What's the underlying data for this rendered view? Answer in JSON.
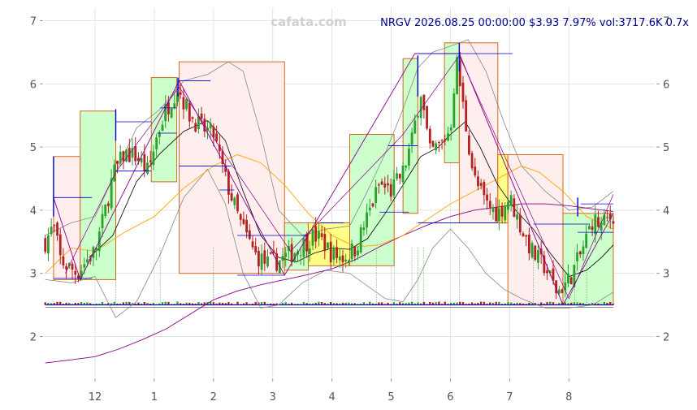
{
  "watermark": "cafata.com",
  "header_text": "NRGV 2026.08.25 00:00:00 $3.93 7.97% vol:3717.6K 0.7x",
  "chart_data": {
    "type": "candlestick",
    "title": "",
    "xlabel": "",
    "ylabel": "",
    "ylim": [
      1.35,
      7.2
    ],
    "x_range_months": [
      10.15,
      20.45
    ],
    "y_ticks": [
      2,
      3,
      4,
      5,
      6,
      7
    ],
    "y_tick_labels": [
      "2",
      "3",
      "4",
      "5",
      "6",
      "7"
    ],
    "x_ticks": [
      {
        "pos": 11,
        "label": "12"
      },
      {
        "pos": 12,
        "label": "1"
      },
      {
        "pos": 13,
        "label": "2"
      },
      {
        "pos": 14,
        "label": "3"
      },
      {
        "pos": 15,
        "label": "4"
      },
      {
        "pos": 16,
        "label": "5"
      },
      {
        "pos": 17,
        "label": "6"
      },
      {
        "pos": 18,
        "label": "7"
      },
      {
        "pos": 19,
        "label": "8"
      }
    ],
    "grid": true,
    "colors": {
      "up": "#2ca02c",
      "down": "#b22222",
      "ma_fast": "#000000",
      "ma_mid": "#ffa500",
      "ma_slow": "#8b008b",
      "bollinger": "#888888",
      "zone_up_fill": "#ccffcc",
      "zone_down_fill": "#ffeeee",
      "zone_neutral_fill": "#ffff88",
      "zone_border": "#d2691e",
      "level_line": "#0000cd",
      "zigzag": "#8b008b"
    },
    "close_series": [
      {
        "x": 10.16,
        "y": 3.5
      },
      {
        "x": 10.3,
        "y": 3.75
      },
      {
        "x": 10.42,
        "y": 3.2
      },
      {
        "x": 10.55,
        "y": 3.1
      },
      {
        "x": 10.7,
        "y": 3.0
      },
      {
        "x": 10.85,
        "y": 3.2
      },
      {
        "x": 11.0,
        "y": 3.35
      },
      {
        "x": 11.15,
        "y": 3.9
      },
      {
        "x": 11.3,
        "y": 4.55
      },
      {
        "x": 11.5,
        "y": 4.9
      },
      {
        "x": 11.7,
        "y": 4.85
      },
      {
        "x": 11.9,
        "y": 4.6
      },
      {
        "x": 12.05,
        "y": 5.2
      },
      {
        "x": 12.2,
        "y": 5.6
      },
      {
        "x": 12.4,
        "y": 5.95
      },
      {
        "x": 12.6,
        "y": 5.5
      },
      {
        "x": 12.8,
        "y": 5.3
      },
      {
        "x": 13.0,
        "y": 5.2
      },
      {
        "x": 13.2,
        "y": 4.5
      },
      {
        "x": 13.45,
        "y": 3.8
      },
      {
        "x": 13.7,
        "y": 3.3
      },
      {
        "x": 13.9,
        "y": 3.15
      },
      {
        "x": 14.1,
        "y": 3.2
      },
      {
        "x": 14.3,
        "y": 3.3
      },
      {
        "x": 14.5,
        "y": 3.45
      },
      {
        "x": 14.7,
        "y": 3.6
      },
      {
        "x": 14.85,
        "y": 3.5
      },
      {
        "x": 15.0,
        "y": 3.3
      },
      {
        "x": 15.2,
        "y": 3.25
      },
      {
        "x": 15.4,
        "y": 3.4
      },
      {
        "x": 15.6,
        "y": 3.9
      },
      {
        "x": 15.8,
        "y": 4.4
      },
      {
        "x": 16.0,
        "y": 4.3
      },
      {
        "x": 16.2,
        "y": 4.6
      },
      {
        "x": 16.35,
        "y": 5.1
      },
      {
        "x": 16.5,
        "y": 5.9
      },
      {
        "x": 16.65,
        "y": 4.9
      },
      {
        "x": 16.85,
        "y": 5.05
      },
      {
        "x": 17.0,
        "y": 5.3
      },
      {
        "x": 17.1,
        "y": 6.4
      },
      {
        "x": 17.25,
        "y": 5.4
      },
      {
        "x": 17.4,
        "y": 4.5
      },
      {
        "x": 17.6,
        "y": 4.1
      },
      {
        "x": 17.8,
        "y": 3.95
      },
      {
        "x": 18.0,
        "y": 4.2
      },
      {
        "x": 18.2,
        "y": 3.7
      },
      {
        "x": 18.4,
        "y": 3.3
      },
      {
        "x": 18.6,
        "y": 3.1
      },
      {
        "x": 18.8,
        "y": 2.7
      },
      {
        "x": 19.0,
        "y": 2.9
      },
      {
        "x": 19.2,
        "y": 3.3
      },
      {
        "x": 19.4,
        "y": 3.85
      },
      {
        "x": 19.55,
        "y": 3.75
      },
      {
        "x": 19.75,
        "y": 3.93
      }
    ],
    "zones": [
      {
        "kind": "down",
        "x0": 10.3,
        "x1": 10.75,
        "y0": 2.9,
        "y1": 4.85
      },
      {
        "kind": "up",
        "x0": 10.75,
        "x1": 11.35,
        "y0": 2.9,
        "y1": 5.57
      },
      {
        "kind": "up",
        "x0": 11.95,
        "x1": 12.38,
        "y0": 4.45,
        "y1": 6.1
      },
      {
        "kind": "down",
        "x0": 12.42,
        "x1": 14.2,
        "y0": 3.0,
        "y1": 6.35
      },
      {
        "kind": "up",
        "x0": 14.2,
        "x1": 14.6,
        "y0": 3.05,
        "y1": 3.8
      },
      {
        "kind": "neutral",
        "x0": 14.6,
        "x1": 15.3,
        "y0": 3.12,
        "y1": 3.8
      },
      {
        "kind": "up",
        "x0": 15.3,
        "x1": 16.05,
        "y0": 3.12,
        "y1": 5.2
      },
      {
        "kind": "up",
        "x0": 16.2,
        "x1": 16.45,
        "y0": 3.95,
        "y1": 6.4
      },
      {
        "kind": "up",
        "x0": 16.9,
        "x1": 17.15,
        "y0": 4.75,
        "y1": 6.65
      },
      {
        "kind": "down",
        "x0": 17.15,
        "x1": 17.8,
        "y0": 3.8,
        "y1": 6.65
      },
      {
        "kind": "neutral",
        "x0": 17.8,
        "x1": 17.97,
        "y0": 3.8,
        "y1": 4.88
      },
      {
        "kind": "down",
        "x0": 17.97,
        "x1": 18.9,
        "y0": 2.5,
        "y1": 4.88
      },
      {
        "kind": "up",
        "x0": 18.9,
        "x1": 19.75,
        "y0": 2.5,
        "y1": 3.95
      }
    ],
    "level_lines": [
      {
        "x0": 10.3,
        "x1": 10.95,
        "y": 4.2
      },
      {
        "x0": 10.3,
        "x1": 10.95,
        "y": 2.92
      },
      {
        "x0": 11.35,
        "x1": 11.95,
        "y": 5.4
      },
      {
        "x0": 11.35,
        "x1": 11.95,
        "y": 4.62
      },
      {
        "x0": 12.1,
        "x1": 12.38,
        "y": 5.62
      },
      {
        "x0": 12.05,
        "x1": 12.38,
        "y": 5.22
      },
      {
        "x0": 12.42,
        "x1": 12.95,
        "y": 6.05
      },
      {
        "x0": 12.42,
        "x1": 13.3,
        "y": 4.7
      },
      {
        "x0": 13.1,
        "x1": 13.35,
        "y": 4.32
      },
      {
        "x0": 13.4,
        "x1": 14.6,
        "y": 3.6
      },
      {
        "x0": 13.4,
        "x1": 14.2,
        "y": 2.97
      },
      {
        "x0": 14.8,
        "x1": 15.2,
        "y": 3.8
      },
      {
        "x0": 15.95,
        "x1": 16.45,
        "y": 5.02
      },
      {
        "x0": 15.8,
        "x1": 16.3,
        "y": 3.97
      },
      {
        "x0": 16.45,
        "x1": 18.05,
        "y": 6.48
      },
      {
        "x0": 16.45,
        "x1": 17.8,
        "y": 3.8
      },
      {
        "x0": 18.4,
        "x1": 19.35,
        "y": 3.78
      },
      {
        "x0": 19.2,
        "x1": 19.75,
        "y": 4.1
      },
      {
        "x0": 19.15,
        "x1": 19.75,
        "y": 3.65
      }
    ],
    "zigzag": [
      {
        "x": 10.3,
        "y": 4.2
      },
      {
        "x": 10.75,
        "y": 2.9
      },
      {
        "x": 12.42,
        "y": 6.05
      },
      {
        "x": 14.2,
        "y": 2.97
      },
      {
        "x": 16.4,
        "y": 6.48
      },
      {
        "x": 17.15,
        "y": 6.48
      },
      {
        "x": 18.9,
        "y": 2.5
      },
      {
        "x": 19.75,
        "y": 3.95
      }
    ],
    "zigzag_secondary": [
      {
        "x": 10.5,
        "y": 3.0
      },
      {
        "x": 11.35,
        "y": 4.6
      },
      {
        "x": 12.42,
        "y": 5.95
      },
      {
        "x": 14.3,
        "y": 3.35
      },
      {
        "x": 16.2,
        "y": 5.2
      },
      {
        "x": 17.15,
        "y": 6.45
      },
      {
        "x": 19.0,
        "y": 2.6
      },
      {
        "x": 19.75,
        "y": 4.25
      }
    ],
    "ma_fast": [
      {
        "x": 10.9,
        "y": 3.25
      },
      {
        "x": 11.3,
        "y": 3.6
      },
      {
        "x": 11.7,
        "y": 4.45
      },
      {
        "x": 12.1,
        "y": 4.9
      },
      {
        "x": 12.5,
        "y": 5.25
      },
      {
        "x": 12.9,
        "y": 5.42
      },
      {
        "x": 13.2,
        "y": 5.1
      },
      {
        "x": 13.5,
        "y": 4.3
      },
      {
        "x": 13.8,
        "y": 3.6
      },
      {
        "x": 14.1,
        "y": 3.25
      },
      {
        "x": 14.4,
        "y": 3.18
      },
      {
        "x": 14.7,
        "y": 3.32
      },
      {
        "x": 15.0,
        "y": 3.4
      },
      {
        "x": 15.3,
        "y": 3.38
      },
      {
        "x": 15.6,
        "y": 3.55
      },
      {
        "x": 15.9,
        "y": 3.95
      },
      {
        "x": 16.2,
        "y": 4.4
      },
      {
        "x": 16.5,
        "y": 4.85
      },
      {
        "x": 16.8,
        "y": 5.0
      },
      {
        "x": 17.0,
        "y": 5.2
      },
      {
        "x": 17.25,
        "y": 5.4
      },
      {
        "x": 17.5,
        "y": 5.0
      },
      {
        "x": 17.8,
        "y": 4.4
      },
      {
        "x": 18.1,
        "y": 4.0
      },
      {
        "x": 18.4,
        "y": 3.7
      },
      {
        "x": 18.7,
        "y": 3.3
      },
      {
        "x": 19.0,
        "y": 2.95
      },
      {
        "x": 19.3,
        "y": 3.05
      },
      {
        "x": 19.55,
        "y": 3.25
      },
      {
        "x": 19.75,
        "y": 3.45
      }
    ],
    "ma_mid": [
      {
        "x": 10.16,
        "y": 3.0
      },
      {
        "x": 10.6,
        "y": 3.4
      },
      {
        "x": 11.0,
        "y": 3.35
      },
      {
        "x": 11.5,
        "y": 3.65
      },
      {
        "x": 12.0,
        "y": 3.9
      },
      {
        "x": 12.5,
        "y": 4.35
      },
      {
        "x": 13.0,
        "y": 4.7
      },
      {
        "x": 13.4,
        "y": 4.88
      },
      {
        "x": 13.8,
        "y": 4.75
      },
      {
        "x": 14.2,
        "y": 4.4
      },
      {
        "x": 14.6,
        "y": 3.95
      },
      {
        "x": 15.0,
        "y": 3.6
      },
      {
        "x": 15.4,
        "y": 3.42
      },
      {
        "x": 15.8,
        "y": 3.45
      },
      {
        "x": 16.2,
        "y": 3.6
      },
      {
        "x": 16.6,
        "y": 3.85
      },
      {
        "x": 17.0,
        "y": 4.1
      },
      {
        "x": 17.4,
        "y": 4.3
      },
      {
        "x": 17.8,
        "y": 4.5
      },
      {
        "x": 18.2,
        "y": 4.7
      },
      {
        "x": 18.5,
        "y": 4.6
      },
      {
        "x": 18.9,
        "y": 4.3
      },
      {
        "x": 19.3,
        "y": 3.9
      },
      {
        "x": 19.75,
        "y": 3.7
      }
    ],
    "ma_slow": [
      {
        "x": 10.16,
        "y": 1.58
      },
      {
        "x": 10.6,
        "y": 1.63
      },
      {
        "x": 11.0,
        "y": 1.68
      },
      {
        "x": 11.4,
        "y": 1.8
      },
      {
        "x": 11.8,
        "y": 1.95
      },
      {
        "x": 12.2,
        "y": 2.12
      },
      {
        "x": 12.6,
        "y": 2.35
      },
      {
        "x": 13.0,
        "y": 2.58
      },
      {
        "x": 13.4,
        "y": 2.72
      },
      {
        "x": 13.8,
        "y": 2.82
      },
      {
        "x": 14.2,
        "y": 2.9
      },
      {
        "x": 14.6,
        "y": 2.98
      },
      {
        "x": 15.0,
        "y": 3.07
      },
      {
        "x": 15.4,
        "y": 3.22
      },
      {
        "x": 15.8,
        "y": 3.42
      },
      {
        "x": 16.2,
        "y": 3.6
      },
      {
        "x": 16.6,
        "y": 3.76
      },
      {
        "x": 17.0,
        "y": 3.9
      },
      {
        "x": 17.4,
        "y": 4.0
      },
      {
        "x": 17.8,
        "y": 4.05
      },
      {
        "x": 18.2,
        "y": 4.1
      },
      {
        "x": 18.6,
        "y": 4.1
      },
      {
        "x": 19.0,
        "y": 4.07
      },
      {
        "x": 19.4,
        "y": 4.02
      },
      {
        "x": 19.75,
        "y": 3.98
      }
    ],
    "bollinger_upper": [
      {
        "x": 10.16,
        "y": 3.6
      },
      {
        "x": 10.6,
        "y": 3.8
      },
      {
        "x": 11.0,
        "y": 3.9
      },
      {
        "x": 11.35,
        "y": 4.6
      },
      {
        "x": 11.7,
        "y": 5.3
      },
      {
        "x": 12.1,
        "y": 5.6
      },
      {
        "x": 12.5,
        "y": 6.05
      },
      {
        "x": 12.9,
        "y": 6.15
      },
      {
        "x": 13.25,
        "y": 6.35
      },
      {
        "x": 13.5,
        "y": 6.2
      },
      {
        "x": 13.8,
        "y": 5.2
      },
      {
        "x": 14.1,
        "y": 4.0
      },
      {
        "x": 14.5,
        "y": 3.6
      },
      {
        "x": 14.9,
        "y": 3.7
      },
      {
        "x": 15.3,
        "y": 3.75
      },
      {
        "x": 15.6,
        "y": 4.3
      },
      {
        "x": 15.9,
        "y": 4.9
      },
      {
        "x": 16.2,
        "y": 5.6
      },
      {
        "x": 16.45,
        "y": 6.25
      },
      {
        "x": 16.7,
        "y": 6.5
      },
      {
        "x": 17.0,
        "y": 6.6
      },
      {
        "x": 17.3,
        "y": 6.7
      },
      {
        "x": 17.6,
        "y": 6.2
      },
      {
        "x": 17.9,
        "y": 5.4
      },
      {
        "x": 18.2,
        "y": 4.7
      },
      {
        "x": 18.6,
        "y": 4.3
      },
      {
        "x": 19.0,
        "y": 4.0
      },
      {
        "x": 19.4,
        "y": 4.05
      },
      {
        "x": 19.75,
        "y": 4.3
      }
    ],
    "bollinger_lower": [
      {
        "x": 10.16,
        "y": 2.9
      },
      {
        "x": 10.6,
        "y": 2.85
      },
      {
        "x": 11.0,
        "y": 2.95
      },
      {
        "x": 11.35,
        "y": 2.3
      },
      {
        "x": 11.7,
        "y": 2.55
      },
      {
        "x": 12.1,
        "y": 3.3
      },
      {
        "x": 12.5,
        "y": 4.2
      },
      {
        "x": 12.9,
        "y": 4.65
      },
      {
        "x": 13.2,
        "y": 4.1
      },
      {
        "x": 13.5,
        "y": 3.0
      },
      {
        "x": 13.8,
        "y": 2.45
      },
      {
        "x": 14.1,
        "y": 2.5
      },
      {
        "x": 14.5,
        "y": 2.85
      },
      {
        "x": 14.9,
        "y": 3.05
      },
      {
        "x": 15.3,
        "y": 3.0
      },
      {
        "x": 15.6,
        "y": 2.8
      },
      {
        "x": 15.9,
        "y": 2.6
      },
      {
        "x": 16.2,
        "y": 2.55
      },
      {
        "x": 16.45,
        "y": 2.9
      },
      {
        "x": 16.7,
        "y": 3.4
      },
      {
        "x": 17.0,
        "y": 3.7
      },
      {
        "x": 17.3,
        "y": 3.4
      },
      {
        "x": 17.6,
        "y": 3.0
      },
      {
        "x": 17.9,
        "y": 2.75
      },
      {
        "x": 18.2,
        "y": 2.6
      },
      {
        "x": 18.6,
        "y": 2.45
      },
      {
        "x": 19.0,
        "y": 2.45
      },
      {
        "x": 19.4,
        "y": 2.5
      },
      {
        "x": 19.75,
        "y": 2.7
      }
    ],
    "signal_lines_x": [
      11.35,
      12.1,
      13.0,
      14.6,
      15.75,
      16.05,
      16.35,
      16.45,
      16.55,
      17.15,
      18.4,
      19.1,
      19.3
    ],
    "volume_baseline": 2.5
  }
}
